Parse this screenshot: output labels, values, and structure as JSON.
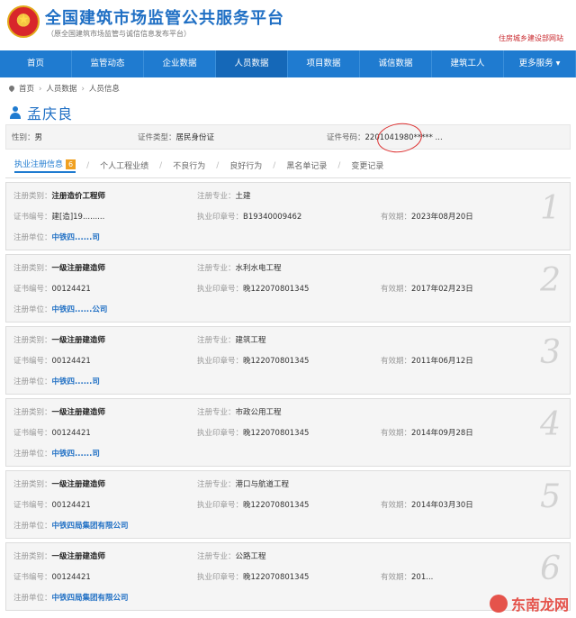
{
  "header": {
    "title": "全国建筑市场监管公共服务平台",
    "subtitle": "（原全国建筑市场监管与诚信信息发布平台）",
    "ministry_link": "住房城乡建设部网站"
  },
  "nav": [
    "首页",
    "监管动态",
    "企业数据",
    "人员数据",
    "项目数据",
    "诚信数据",
    "建筑工人",
    "更多服务 ▾"
  ],
  "breadcrumb": [
    "首页",
    "人员数据",
    "人员信息"
  ],
  "person": {
    "name": "孟庆良"
  },
  "info": {
    "gender_label": "性别：",
    "gender": "男",
    "idtype_label": "证件类型：",
    "idtype": "居民身份证",
    "idno_label": "证件号码：",
    "idno": "2201041980*****  ..."
  },
  "tabs": [
    {
      "label": "执业注册信息",
      "badge": "6"
    },
    {
      "label": "个人工程业绩"
    },
    {
      "label": "不良行为"
    },
    {
      "label": "良好行为"
    },
    {
      "label": "黑名单记录"
    },
    {
      "label": "变更记录"
    }
  ],
  "labels": {
    "reg_type": "注册类别：",
    "specialty": "注册专业：",
    "cert_no": "证书编号：",
    "seal_no": "执业印章号：",
    "valid": "有效期：",
    "unit": "注册单位："
  },
  "records": [
    {
      "num": "1",
      "type": "注册造价工程师",
      "specialty": "土建",
      "cert": "建[造]19.........",
      "seal": "B19340009462",
      "valid": "2023年08月20日",
      "unit": "中铁四......司"
    },
    {
      "num": "2",
      "type": "一级注册建造师",
      "specialty": "水利水电工程",
      "cert": "00124421",
      "seal": "晚122070801345",
      "valid": "2017年02月23日",
      "unit": "中铁四......公司"
    },
    {
      "num": "3",
      "type": "一级注册建造师",
      "specialty": "建筑工程",
      "cert": "00124421",
      "seal": "晚122070801345",
      "valid": "2011年06月12日",
      "unit": "中铁四......司"
    },
    {
      "num": "4",
      "type": "一级注册建造师",
      "specialty": "市政公用工程",
      "cert": "00124421",
      "seal": "晚122070801345",
      "valid": "2014年09月28日",
      "unit": "中铁四......司"
    },
    {
      "num": "5",
      "type": "一级注册建造师",
      "specialty": "港口与航道工程",
      "cert": "00124421",
      "seal": "晚122070801345",
      "valid": "2014年03月30日",
      "unit": "中铁四局集团有限公司"
    },
    {
      "num": "6",
      "type": "一级注册建造师",
      "specialty": "公路工程",
      "cert": "00124421",
      "seal": "晚122070801345",
      "valid": "201...",
      "unit": "中铁四局集团有限公司"
    }
  ],
  "watermark": "东南龙网"
}
